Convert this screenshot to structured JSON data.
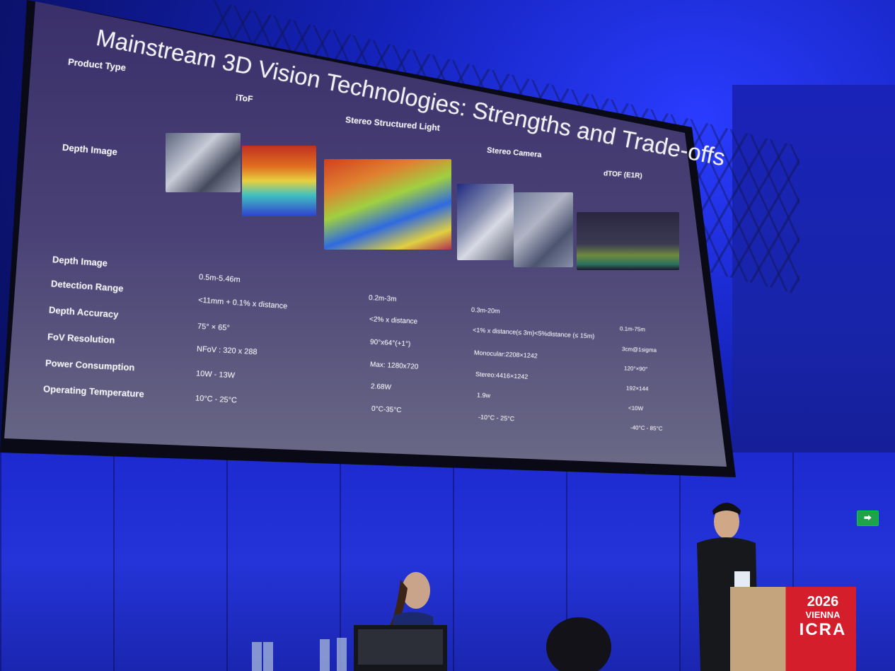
{
  "slide": {
    "title": "Mainstream 3D Vision Technologies: Strengths and Trade-offs",
    "product_type_label": "Product Type",
    "products": [
      "iToF",
      "Stereo Structured Light",
      "Stereo Camera",
      "dTOF (E1R)"
    ],
    "depth_image_label": "Depth Image",
    "row_labels": [
      "Depth Image",
      "Detection Range",
      "Depth Accuracy",
      "FoV Resolution",
      "Power Consumption",
      "Operating Temperature"
    ],
    "itof": [
      "0.5m-5.46m",
      "<11mm + 0.1% x distance",
      "75° × 65°",
      "NFoV : 320 x 288",
      "10W - 13W",
      "10°C - 25°C"
    ],
    "ssl": [
      "0.2m-3m",
      "<2% x distance",
      "90°x64°(+1°)",
      "Max: 1280x720",
      "2.68W",
      "0°C-35°C"
    ],
    "stereo": [
      "0.3m-20m",
      "<1% x distance(≤ 3m)<5%distance (≤ 15m)",
      "Monocular:2208×1242",
      "Stereo:4416×1242",
      "1.9w",
      "-10°C - 25°C"
    ],
    "dtof": [
      "0.1m-75m",
      "3cm@1sigma",
      "120°×90°",
      "192×144",
      "<10W",
      "-40°C - 85°C"
    ]
  },
  "scene": {
    "podium_logo_year": "2026",
    "podium_logo_city": "VIENNA",
    "podium_logo_name": "ICRA",
    "exit_sign": "EXIT"
  },
  "colors": {
    "stage_blue": "#1f2fd0",
    "podium_red": "#d51e2b",
    "slide_bg": "#4a4276"
  }
}
